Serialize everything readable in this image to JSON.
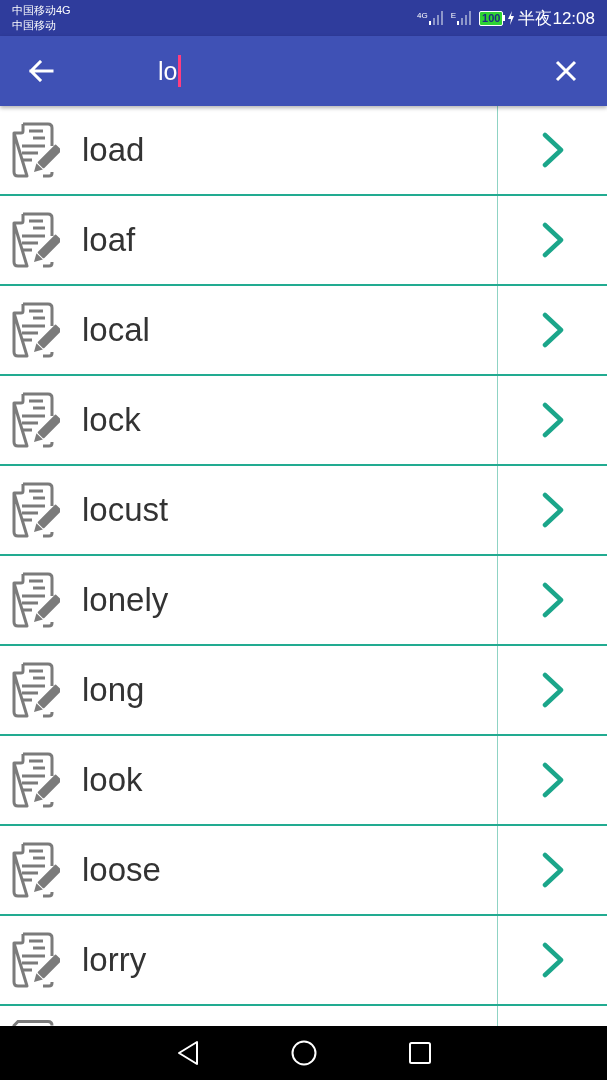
{
  "status_bar": {
    "carriers": [
      "中国移动4G",
      "中国移动"
    ],
    "signals": [
      {
        "label": "4G"
      },
      {
        "label": "E"
      }
    ],
    "battery": "100",
    "charging": true,
    "time": "半夜12:08"
  },
  "search": {
    "value": "lo"
  },
  "results": [
    {
      "word": "load"
    },
    {
      "word": "loaf"
    },
    {
      "word": "local"
    },
    {
      "word": "lock"
    },
    {
      "word": "locust"
    },
    {
      "word": "lonely"
    },
    {
      "word": "long"
    },
    {
      "word": "look"
    },
    {
      "word": "loose"
    },
    {
      "word": "lorry"
    }
  ]
}
